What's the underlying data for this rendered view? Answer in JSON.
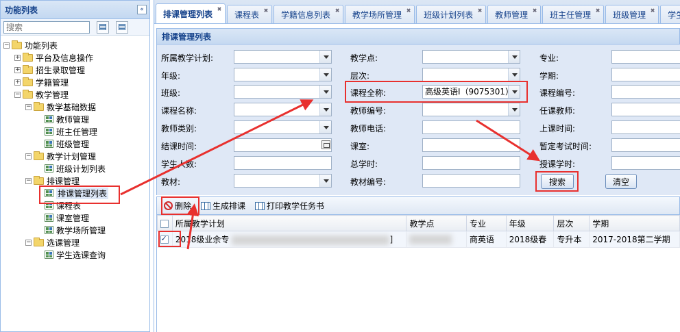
{
  "left_panel": {
    "title": "功能列表",
    "collapse_glyph": "«",
    "search_placeholder": "搜索",
    "tree": [
      {
        "label": "功能列表",
        "type": "folder",
        "level": 0,
        "expander": "-"
      },
      {
        "label": "平台及信息操作",
        "type": "folder",
        "level": 1,
        "expander": "+"
      },
      {
        "label": "招生录取管理",
        "type": "folder",
        "level": 1,
        "expander": "+"
      },
      {
        "label": "学籍管理",
        "type": "folder",
        "level": 1,
        "expander": "+"
      },
      {
        "label": "教学管理",
        "type": "folder",
        "level": 1,
        "expander": "-"
      },
      {
        "label": "教学基础数据",
        "type": "folder",
        "level": 2,
        "expander": "-"
      },
      {
        "label": "教师管理",
        "type": "leaf",
        "level": 3
      },
      {
        "label": "班主任管理",
        "type": "leaf",
        "level": 3
      },
      {
        "label": "班级管理",
        "type": "leaf",
        "level": 3
      },
      {
        "label": "教学计划管理",
        "type": "folder",
        "level": 2,
        "expander": "-"
      },
      {
        "label": "班级计划列表",
        "type": "leaf",
        "level": 3
      },
      {
        "label": "排课管理",
        "type": "folder",
        "level": 2,
        "expander": "-"
      },
      {
        "label": "排课管理列表",
        "type": "leaf",
        "level": 3,
        "selected": true
      },
      {
        "label": "课程表",
        "type": "leaf",
        "level": 3
      },
      {
        "label": "课室管理",
        "type": "leaf",
        "level": 3
      },
      {
        "label": "教学场所管理",
        "type": "leaf",
        "level": 3
      },
      {
        "label": "选课管理",
        "type": "folder",
        "level": 2,
        "expander": "-"
      },
      {
        "label": "学生选课查询",
        "type": "leaf",
        "level": 3
      }
    ]
  },
  "tabs": [
    {
      "label": "排课管理列表",
      "active": true
    },
    {
      "label": "课程表"
    },
    {
      "label": "学籍信息列表"
    },
    {
      "label": "教学场所管理"
    },
    {
      "label": "班级计划列表"
    },
    {
      "label": "教师管理"
    },
    {
      "label": "班主任管理"
    },
    {
      "label": "班级管理"
    },
    {
      "label": "学生"
    }
  ],
  "tab_close_glyph": "✖",
  "panel_title": "排课管理列表",
  "form": {
    "col1": [
      {
        "label": "所属教学计划:",
        "kind": "select",
        "value": ""
      },
      {
        "label": "年级:",
        "kind": "select",
        "value": ""
      },
      {
        "label": "班级:",
        "kind": "select",
        "value": ""
      },
      {
        "label": "课程名称:",
        "kind": "select",
        "value": ""
      },
      {
        "label": "教师类别:",
        "kind": "select",
        "value": ""
      },
      {
        "label": "结课时间:",
        "kind": "date",
        "value": ""
      },
      {
        "label": "学生人数:",
        "kind": "text",
        "value": ""
      },
      {
        "label": "教材:",
        "kind": "select",
        "value": ""
      }
    ],
    "col2": [
      {
        "label": "教学点:",
        "kind": "select",
        "value": ""
      },
      {
        "label": "层次:",
        "kind": "select",
        "value": ""
      },
      {
        "label": "课程全称:",
        "kind": "select",
        "value": "高级英语I（9075301）"
      },
      {
        "label": "教师编号:",
        "kind": "select",
        "value": ""
      },
      {
        "label": "教师电话:",
        "kind": "text",
        "value": ""
      },
      {
        "label": "课室:",
        "kind": "text",
        "value": ""
      },
      {
        "label": "总学时:",
        "kind": "text",
        "value": ""
      },
      {
        "label": "教材编号:",
        "kind": "text",
        "value": ""
      }
    ],
    "col3": [
      {
        "label": "专业:",
        "kind": "text",
        "value": ""
      },
      {
        "label": "学期:",
        "kind": "text",
        "value": ""
      },
      {
        "label": "课程编号:",
        "kind": "text",
        "value": ""
      },
      {
        "label": "任课教师:",
        "kind": "text",
        "value": ""
      },
      {
        "label": "上课时间:",
        "kind": "text",
        "value": ""
      },
      {
        "label": "暂定考试时间:",
        "kind": "text",
        "value": ""
      },
      {
        "label": "授课学时:",
        "kind": "text",
        "value": ""
      }
    ],
    "search_button": "搜索",
    "clear_button": "清空"
  },
  "grid_toolbar": {
    "delete": "删除",
    "generate": "生成排课",
    "print": "打印教学任务书"
  },
  "grid": {
    "columns": [
      "所属教学计划",
      "教学点",
      "专业",
      "年级",
      "层次",
      "学期"
    ],
    "rows": [
      {
        "checked": true,
        "plan": "2018级业余专",
        "plan_tail": "]",
        "school": "",
        "major": "商英语",
        "grade": "2018级春",
        "level": "专升本",
        "term": "2017-2018第二学期"
      }
    ]
  },
  "colors": {
    "annotation_red": "#e8302e",
    "header_blue": "#15428b",
    "panel_bg": "#dfe8f6"
  }
}
